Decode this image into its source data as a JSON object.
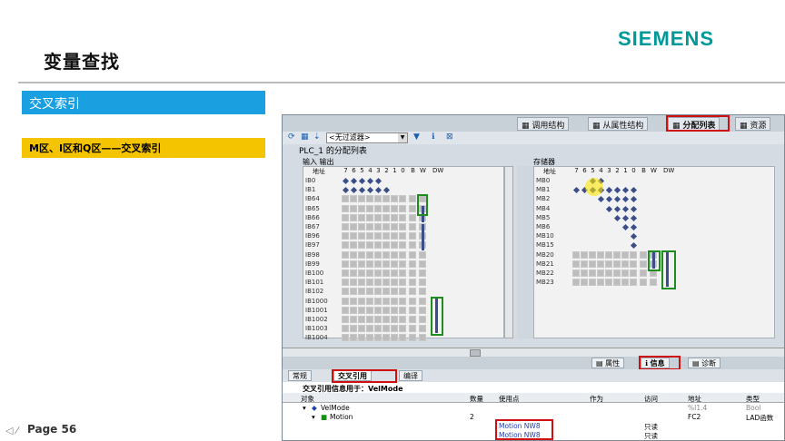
{
  "slide": {
    "title": "变量查找",
    "logo": "SIEMENS",
    "section_title": "交叉索引",
    "highlight_text": "M区、I区和Q区——交叉索引",
    "page_label": "Page 56"
  },
  "window": {
    "top_tabs": [
      "调用结构",
      "从属性结构",
      "分配列表",
      "资源"
    ],
    "filter_value": "<无过滤器>",
    "plc_title": "PLC_1 的分配列表",
    "input_label": "输入  输出",
    "memory_label": "存储器",
    "bit_headers": [
      "地址",
      "7",
      "6",
      "5",
      "4",
      "3",
      "2",
      "1",
      "0",
      "B",
      "W",
      "DW"
    ],
    "input_rows": [
      "IB0",
      "IB1",
      "IB64",
      "IB65",
      "IB66",
      "IB67",
      "IB96",
      "IB97",
      "IB98",
      "IB99",
      "IB100",
      "IB101",
      "IB102",
      "IB1000",
      "IB1001",
      "IB1002",
      "IB1003",
      "IB1004"
    ],
    "memory_rows": [
      "MB0",
      "MB1",
      "MB2",
      "MB4",
      "MB5",
      "MB6",
      "MB10",
      "MB15",
      "MB20",
      "MB21",
      "MB22",
      "MB23"
    ],
    "info_tabs": [
      "属性",
      "信息",
      "诊断"
    ],
    "bottom_tabs": [
      "常规",
      "交叉引用",
      "编译"
    ],
    "xref_title": "交叉引用信息用于：VelMode",
    "xref_headers": [
      "对象",
      "数量",
      "使用点",
      "作为",
      "访问",
      "地址",
      "类型"
    ],
    "xref_rows": [
      {
        "object": "VelMode",
        "count": "",
        "use": "",
        "as": "",
        "access": "",
        "address": "%I1.4",
        "type": "Bool"
      },
      {
        "object": "Motion",
        "count": "2",
        "use": "",
        "as": "",
        "access": "",
        "address": "FC2",
        "type": "LAD函数"
      },
      {
        "object": "",
        "count": "",
        "use": "Motion NW8",
        "as": "",
        "access": "只读",
        "address": "",
        "type": ""
      },
      {
        "object": "",
        "count": "",
        "use": "Motion NW8",
        "as": "",
        "access": "只读",
        "address": "",
        "type": ""
      }
    ]
  },
  "colors": {
    "accent_blue": "#1aa0e0",
    "accent_yellow": "#f5c400",
    "siemens": "#009999"
  }
}
